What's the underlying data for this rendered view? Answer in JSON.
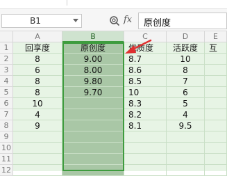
{
  "name_box": {
    "value": "B1"
  },
  "formula_bar": {
    "fx_label": "fx",
    "value": "原创度"
  },
  "columns": [
    "A",
    "B",
    "C",
    "D",
    "E"
  ],
  "row_numbers": [
    "1",
    "2",
    "3",
    "4",
    "5",
    "6",
    "7",
    "8",
    "9",
    "10",
    "11",
    "12"
  ],
  "headers": {
    "A": "回享度",
    "B": "原创度",
    "C": "优质度",
    "D": "活跃度",
    "E": "互"
  },
  "rows": [
    {
      "A": "8",
      "B": "9.00",
      "C": "8.7",
      "D": "10"
    },
    {
      "A": "6",
      "B": "8.00",
      "C": "8.6",
      "D": "8"
    },
    {
      "A": "8",
      "B": "9.80",
      "C": "8.5",
      "D": "7"
    },
    {
      "A": "8",
      "B": "9.70",
      "C": "10",
      "D": "6"
    },
    {
      "A": "10",
      "B": "",
      "C": "8.3",
      "D": "5"
    },
    {
      "A": "4",
      "B": "",
      "C": "8.2",
      "D": "4"
    },
    {
      "A": "9",
      "B": "",
      "C": "8.1",
      "D": "9.5"
    }
  ],
  "colors": {
    "selection": "#3e9c3e",
    "sheet_bg": "#e7f4e5",
    "selected_column": "#a9c7a6",
    "annotation_arrow": "#e03030"
  },
  "icons": {
    "zoom": "zoom-icon",
    "dropdown": "chevron-down-icon",
    "annotation": "red-arrow-annotation"
  }
}
